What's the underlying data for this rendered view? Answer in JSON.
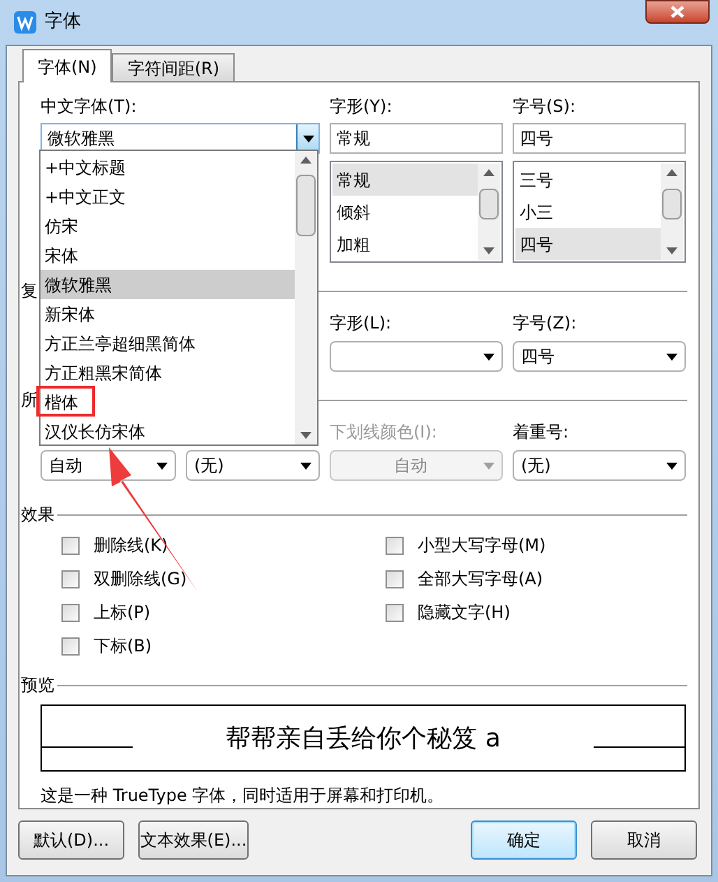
{
  "window": {
    "title": "字体"
  },
  "tabs": [
    {
      "label": "字体(N)",
      "selected": true
    },
    {
      "label": "字符间距(R)",
      "selected": false
    }
  ],
  "chinese_font": {
    "label": "中文字体(T):",
    "value": "微软雅黑",
    "dropdown": [
      {
        "label": "+中文标题",
        "selected": false
      },
      {
        "label": "+中文正文",
        "selected": false
      },
      {
        "label": "仿宋",
        "selected": false
      },
      {
        "label": "宋体",
        "selected": false
      },
      {
        "label": "微软雅黑",
        "selected": true
      },
      {
        "label": "新宋体",
        "selected": false
      },
      {
        "label": "方正兰亭超细黑简体",
        "selected": false
      },
      {
        "label": "方正粗黑宋简体",
        "selected": false
      },
      {
        "label": "楷体",
        "selected": false
      },
      {
        "label": "汉仪长仿宋体",
        "selected": false
      }
    ]
  },
  "style": {
    "label": "字形(Y):",
    "value": "常规",
    "items": [
      {
        "label": "常规",
        "selected": true
      },
      {
        "label": "倾斜",
        "selected": false
      },
      {
        "label": "加粗",
        "selected": false
      }
    ]
  },
  "size": {
    "label": "字号(S):",
    "value": "四号",
    "items": [
      {
        "label": "三号",
        "selected": false
      },
      {
        "label": "小三",
        "selected": false
      },
      {
        "label": "四号",
        "selected": true
      }
    ]
  },
  "complex_section": {
    "label": "复"
  },
  "complex_style": {
    "label": "字形(L):"
  },
  "complex_size": {
    "label": "字号(Z):",
    "value": "四号"
  },
  "all_text_section": {
    "label": "所"
  },
  "font_color": {
    "value": "自动"
  },
  "underline_style": {
    "value": "(无)"
  },
  "underline_color": {
    "label": "下划线颜色(I):",
    "value": "自动",
    "disabled": true
  },
  "emphasis": {
    "label": "着重号:",
    "value": "(无)"
  },
  "effects": {
    "title": "效果",
    "left": [
      {
        "label": "删除线(K)",
        "checked": false
      },
      {
        "label": "双删除线(G)",
        "checked": false
      },
      {
        "label": "上标(P)",
        "checked": false
      },
      {
        "label": "下标(B)",
        "checked": false
      }
    ],
    "right": [
      {
        "label": "小型大写字母(M)",
        "checked": false
      },
      {
        "label": "全部大写字母(A)",
        "checked": false
      },
      {
        "label": "隐藏文字(H)",
        "checked": false
      }
    ]
  },
  "preview": {
    "title": "预览",
    "sample": "帮帮亲自丢给你个秘笈 a"
  },
  "description": "这是一种 TrueType 字体，同时适用于屏幕和打印机。",
  "left_buttons": [
    {
      "label": "默认(D)...",
      "default": false
    },
    {
      "label": "文本效果(E)...",
      "default": false
    }
  ],
  "right_buttons": [
    {
      "label": "确定",
      "default": true
    },
    {
      "label": "取消",
      "default": false
    }
  ]
}
